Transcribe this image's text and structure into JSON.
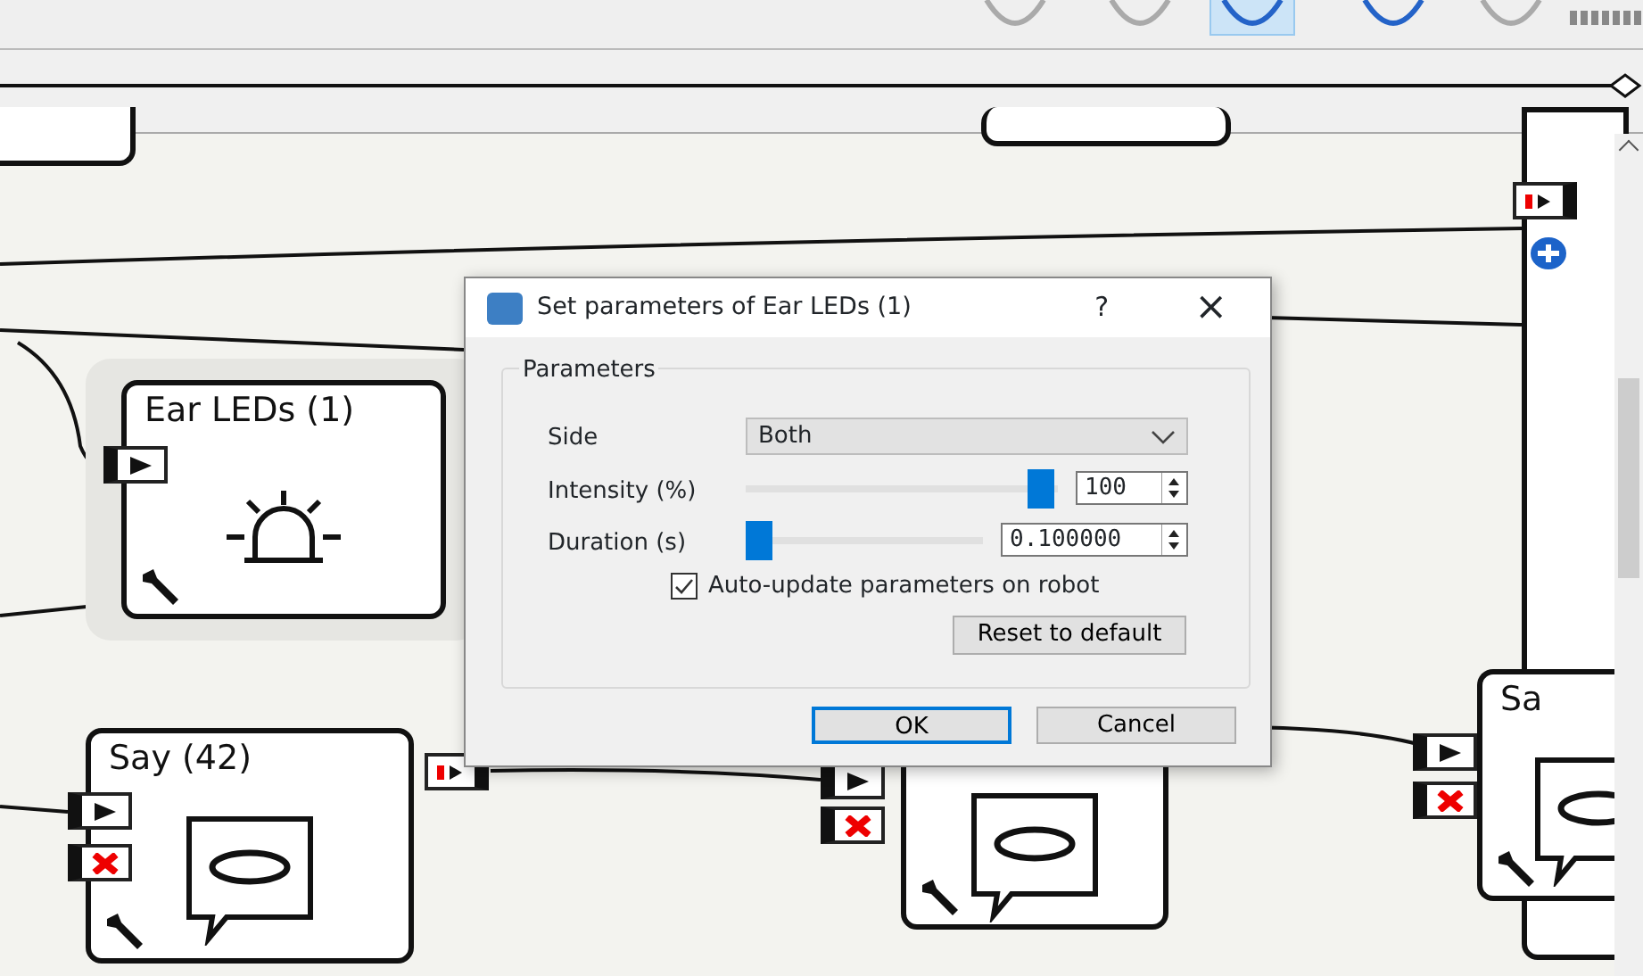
{
  "canvas": {
    "boxes": [
      {
        "title": "Ear LEDs (1)",
        "kind": "leds",
        "selected": true,
        "ports": [
          {
            "kind": "start"
          }
        ]
      },
      {
        "title": "Say (42)",
        "kind": "speech",
        "selected": false,
        "ports": [
          {
            "kind": "start"
          },
          {
            "kind": "stop"
          }
        ]
      },
      {
        "kind": "speech",
        "selected": false,
        "ports": [
          {
            "kind": "start"
          },
          {
            "kind": "stop"
          }
        ]
      },
      {
        "title": "Sa",
        "kind": "speech",
        "selected": false,
        "ports": [
          {
            "kind": "start"
          },
          {
            "kind": "stop"
          }
        ]
      }
    ]
  },
  "dialog": {
    "title": "Set parameters of Ear LEDs (1)",
    "help": "?",
    "close": "×",
    "group": "Parameters",
    "fields": [
      {
        "kind": "select",
        "label": "Side",
        "value": "Both"
      },
      {
        "kind": "slider",
        "label": "Intensity (%)",
        "level": 1.0,
        "value": "100"
      },
      {
        "kind": "slider",
        "label": "Duration (s)",
        "level": 0.0,
        "value": "0.100000"
      }
    ],
    "checkbox": {
      "label": "Auto-update parameters on robot",
      "checked": true
    },
    "reset": "Reset to default",
    "buttons": [
      {
        "label": "OK",
        "default": true
      },
      {
        "label": "Cancel",
        "default": false
      }
    ]
  }
}
